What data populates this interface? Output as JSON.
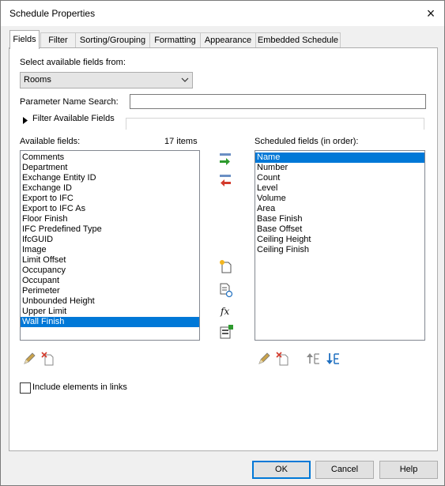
{
  "window": {
    "title": "Schedule Properties",
    "close_icon": "×"
  },
  "tabs": [
    "Fields",
    "Filter",
    "Sorting/Grouping",
    "Formatting",
    "Appearance",
    "Embedded Schedule"
  ],
  "active_tab": "Fields",
  "fields_tab": {
    "select_from_label": "Select available fields from:",
    "category_value": "Rooms",
    "param_search_label": "Parameter Name Search:",
    "param_search_value": "",
    "filter_available_label": "Filter Available Fields",
    "available_label": "Available fields:",
    "available_count": "17 items",
    "available_fields": [
      "Comments",
      "Department",
      "Exchange Entity ID",
      "Exchange ID",
      "Export to IFC",
      "Export to IFC As",
      "Floor Finish",
      "IFC Predefined Type",
      "IfcGUID",
      "Image",
      "Limit Offset",
      "Occupancy",
      "Occupant",
      "Perimeter",
      "Unbounded Height",
      "Upper Limit",
      "Wall Finish"
    ],
    "available_selected": "Wall Finish",
    "scheduled_label": "Scheduled fields (in order):",
    "scheduled_fields": [
      "Name",
      "Number",
      "Count",
      "Level",
      "Volume",
      "Area",
      "Base Finish",
      "Base Offset",
      "Ceiling Height",
      "Ceiling Finish"
    ],
    "scheduled_selected": "Name",
    "include_links_label": "Include elements in links",
    "include_links_checked": false
  },
  "buttons": {
    "ok": "OK",
    "cancel": "Cancel",
    "help": "Help"
  },
  "colors": {
    "selection": "#0078d7",
    "add_arrow": "#2e9a2e",
    "remove_arrow": "#d33a2c",
    "move_arrow": "#1f6fc0"
  }
}
